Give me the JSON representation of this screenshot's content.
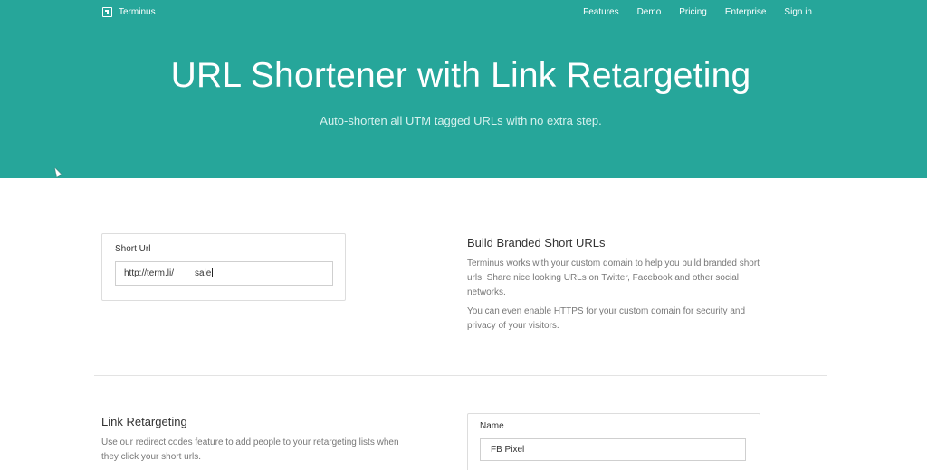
{
  "nav": {
    "brand": "Terminus",
    "links": [
      "Features",
      "Demo",
      "Pricing",
      "Enterprise",
      "Sign in"
    ]
  },
  "hero": {
    "title": "URL Shortener with Link Retargeting",
    "subtitle": "Auto-shorten all UTM tagged URLs with no extra step."
  },
  "short_url": {
    "label": "Short Url",
    "prefix": "http://term.li/",
    "value": "sale"
  },
  "branded": {
    "title": "Build Branded Short URLs",
    "paragraph1": "Terminus works with your custom domain to help you build branded short urls. Share nice looking URLs on Twitter, Facebook and other social networks.",
    "paragraph2": "You can even enable HTTPS for your custom domain for security and privacy of your visitors."
  },
  "retargeting": {
    "title": "Link Retargeting",
    "paragraph": "Use our redirect codes feature to add people to your retargeting lists when they click your short urls."
  },
  "pixel_form": {
    "label": "Name",
    "value": "FB Pixel"
  },
  "colors": {
    "hero_bg": "#26a69a"
  }
}
